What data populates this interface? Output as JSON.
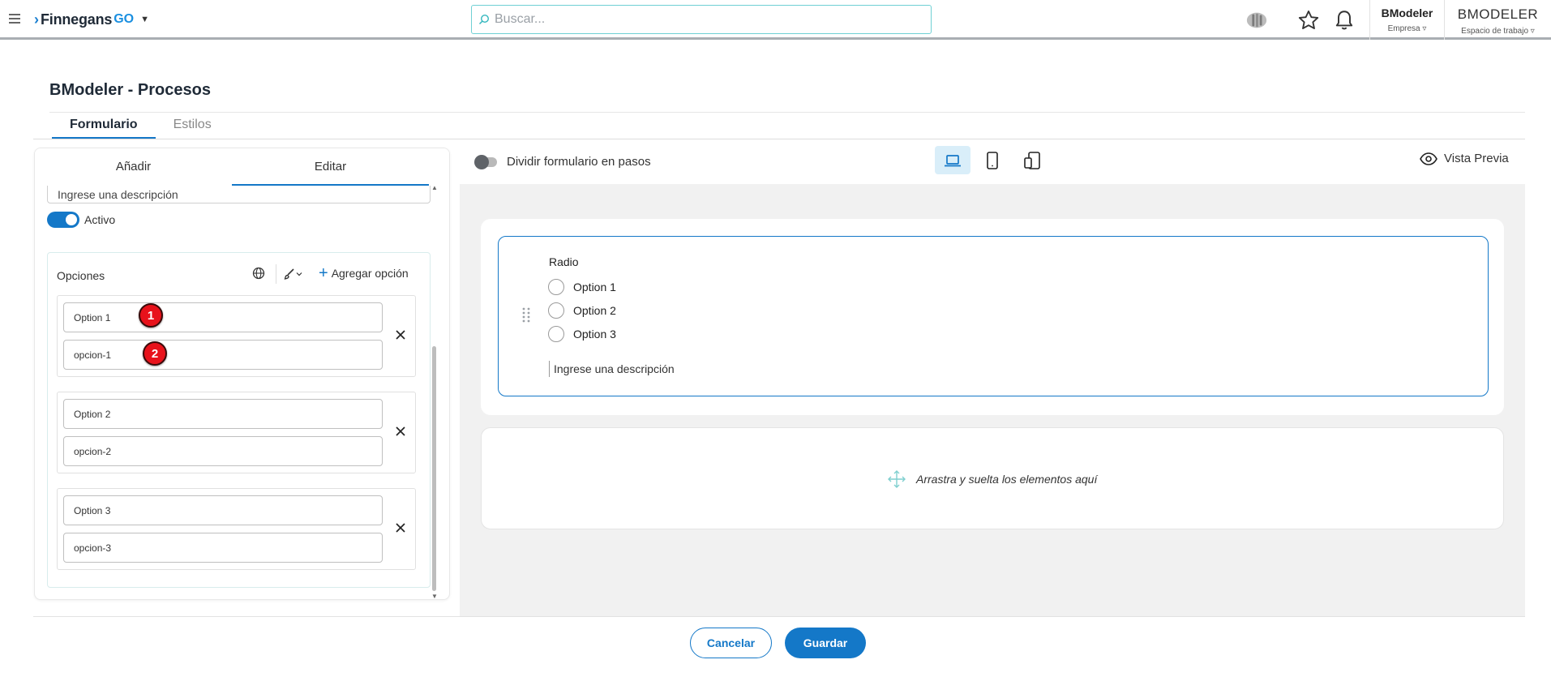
{
  "header": {
    "brand": "Finnegans",
    "brand_suffix": "GO",
    "search_placeholder": "Buscar...",
    "company": {
      "name": "BModeler",
      "label": "Empresa"
    },
    "workspace": {
      "name": "BMODELER",
      "label": "Espacio de trabajo"
    }
  },
  "page": {
    "title": "BModeler - Procesos",
    "tabs": [
      {
        "label": "Formulario",
        "active": true
      },
      {
        "label": "Estilos",
        "active": false
      }
    ]
  },
  "left_panel": {
    "tabs": [
      {
        "label": "Añadir",
        "active": false
      },
      {
        "label": "Editar",
        "active": true
      }
    ],
    "description_value": "Ingrese una descripción",
    "active_label": "Activo",
    "active_on": true,
    "options_title": "Opciones",
    "add_option_label": "Agregar opción",
    "options": [
      {
        "label": "Option 1",
        "value": "opcion-1"
      },
      {
        "label": "Option 2",
        "value": "opcion-2"
      },
      {
        "label": "Option 3",
        "value": "opcion-3"
      }
    ],
    "markers": [
      "1",
      "2"
    ]
  },
  "toolbar": {
    "split_steps_label": "Dividir formulario en pasos",
    "split_steps_on": false,
    "devices": [
      {
        "icon": "laptop-icon",
        "active": true
      },
      {
        "icon": "tablet-icon",
        "active": false
      },
      {
        "icon": "responsive-devices-icon",
        "active": false
      }
    ],
    "preview_label": "Vista Previa"
  },
  "canvas": {
    "radio_field": {
      "label": "Radio",
      "options": [
        "Option 1",
        "Option 2",
        "Option 3"
      ],
      "description": "Ingrese una descripción"
    },
    "dropzone_text": "Arrastra y suelta los elementos aquí"
  },
  "footer": {
    "cancel_label": "Cancelar",
    "save_label": "Guardar"
  },
  "colors": {
    "accent": "#1478c8",
    "marker": "#e8121b",
    "search_border": "#6fd0d4",
    "canvas_bg": "#f1f1f1"
  }
}
